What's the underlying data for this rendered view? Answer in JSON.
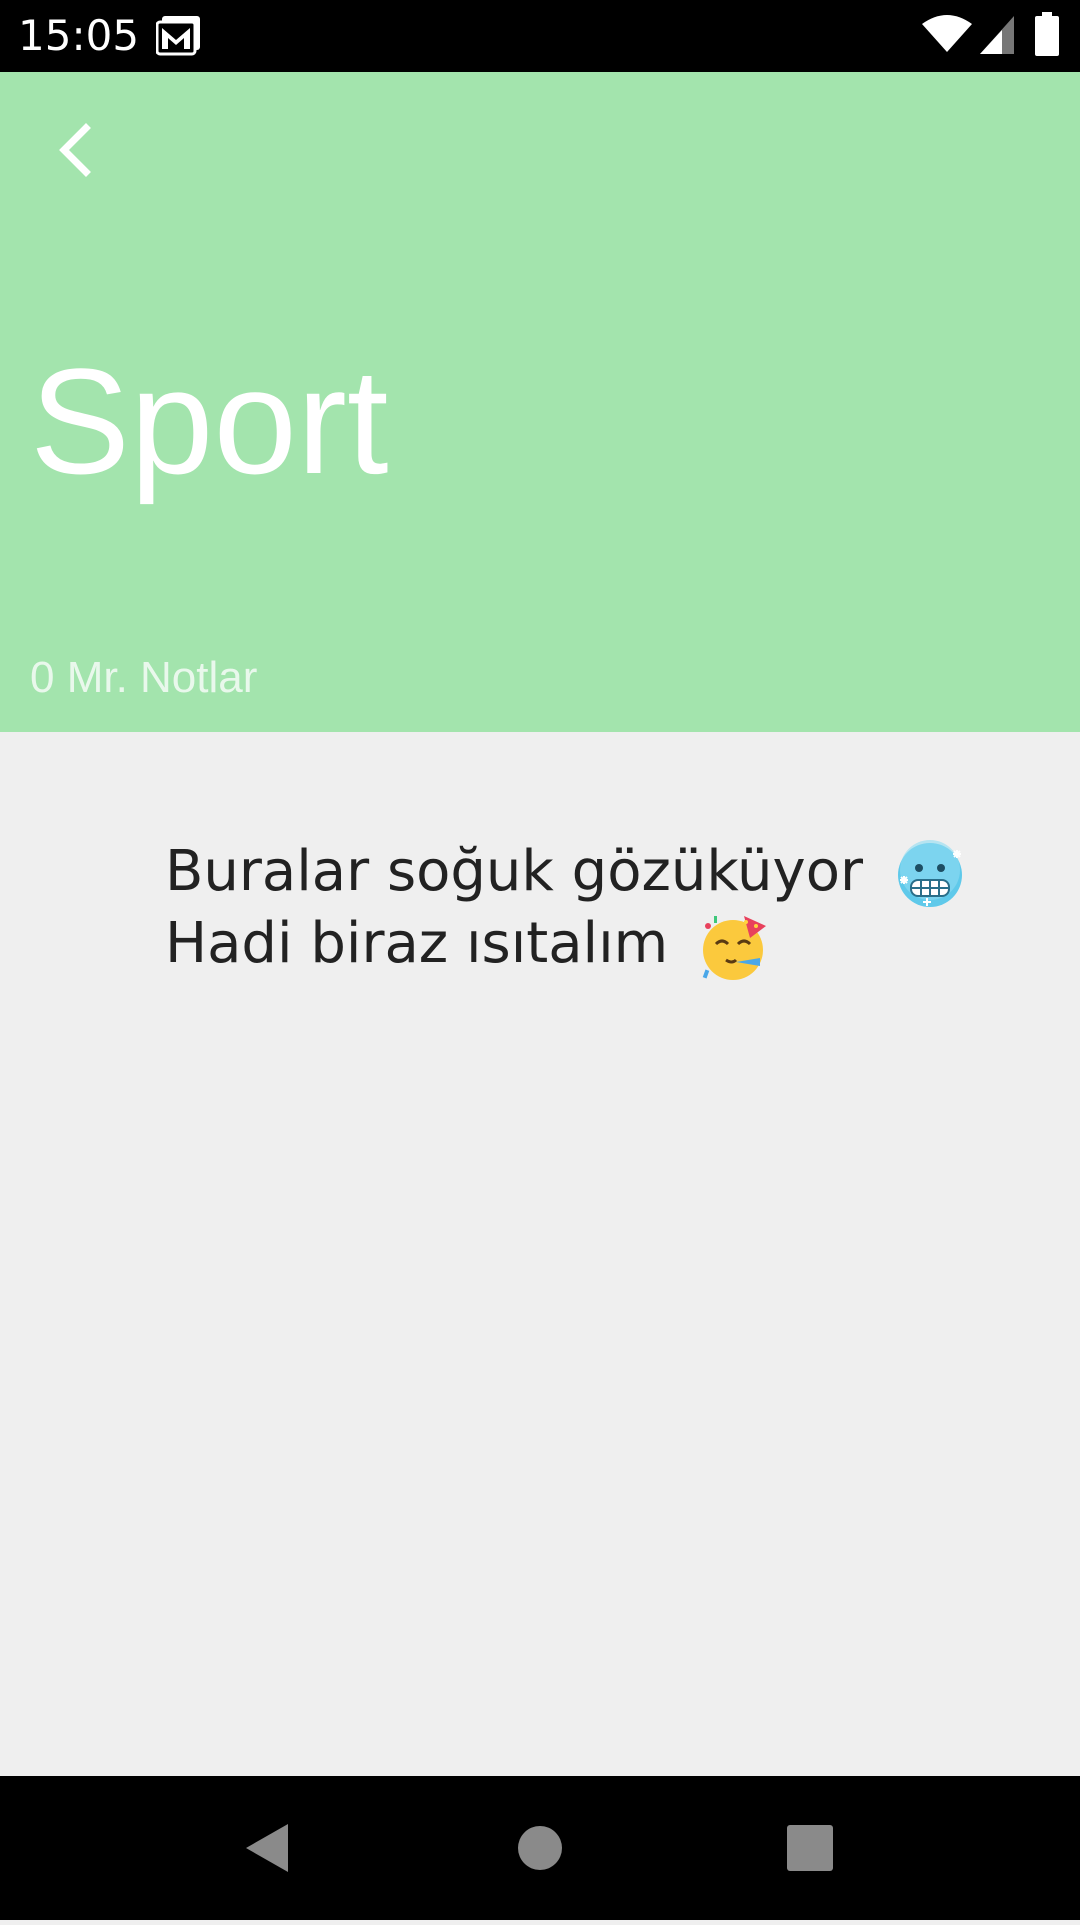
{
  "status_bar": {
    "time": "15:05",
    "icons": [
      "gmail-icon",
      "wifi-icon",
      "signal-icon",
      "battery-icon"
    ]
  },
  "header": {
    "title": "Sport",
    "note_count": "0 Mr. Notlar",
    "background_color": "#a3e4ad",
    "back_icon": "chevron-left-icon"
  },
  "empty_state": {
    "line1": "Buralar soğuk gözüküyor",
    "line1_emoji": "cold-face-emoji",
    "line2": "Hadi biraz ısıtalım",
    "line2_emoji": "partying-face-emoji"
  },
  "nav_bar": {
    "buttons": [
      "back-triangle-icon",
      "home-circle-icon",
      "recents-square-icon"
    ]
  }
}
